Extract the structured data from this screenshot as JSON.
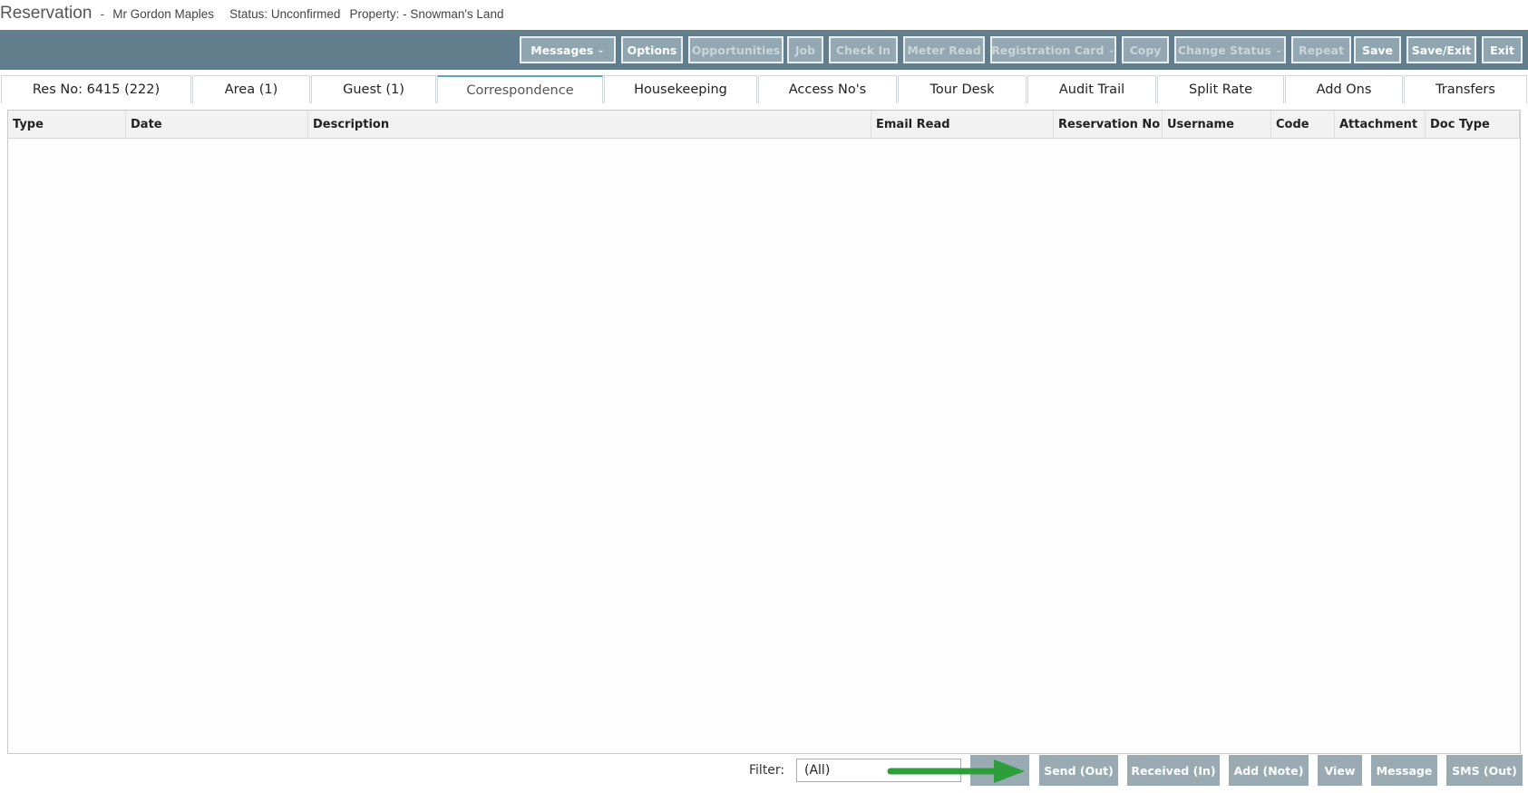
{
  "header": {
    "title": "Reservation",
    "separator": "-",
    "guest": "Mr Gordon Maples",
    "status": "Status: Unconfirmed",
    "property": "Property: - Snowman's Land"
  },
  "toolbar": {
    "messages": "Messages",
    "options": "Options",
    "opportunities": "Opportunities",
    "job": "Job",
    "check_in": "Check In",
    "meter_read": "Meter Read",
    "registration_card": "Registration Card",
    "copy": "Copy",
    "change_status": "Change Status",
    "repeat": "Repeat",
    "save": "Save",
    "save_exit": "Save/Exit",
    "exit": "Exit",
    "caret": "⌄"
  },
  "tabs": [
    "Res No: 6415 (222)",
    "Area (1)",
    "Guest (1)",
    "Correspondence",
    "Housekeeping",
    "Access No's",
    "Tour Desk",
    "Audit Trail",
    "Split Rate",
    "Add Ons",
    "Transfers"
  ],
  "active_tab": "Correspondence",
  "table": {
    "columns": [
      "Type",
      "Date",
      "Description",
      "Email Read",
      "Reservation No",
      "Username",
      "Code",
      "Attachment",
      "Doc Type"
    ],
    "rows": []
  },
  "footer": {
    "filter_label": "Filter:",
    "filter_value": "(All)",
    "buttons": [
      "Send (Out)",
      "Received (In)",
      "Add (Note)",
      "View",
      "Message",
      "SMS (Out)"
    ]
  },
  "colors": {
    "toolbar_bg": "#627d8c",
    "button_bg": "#8fa5b0",
    "active_tab_accent": "#5aa7b5",
    "arrow": "#2e9e3a"
  }
}
